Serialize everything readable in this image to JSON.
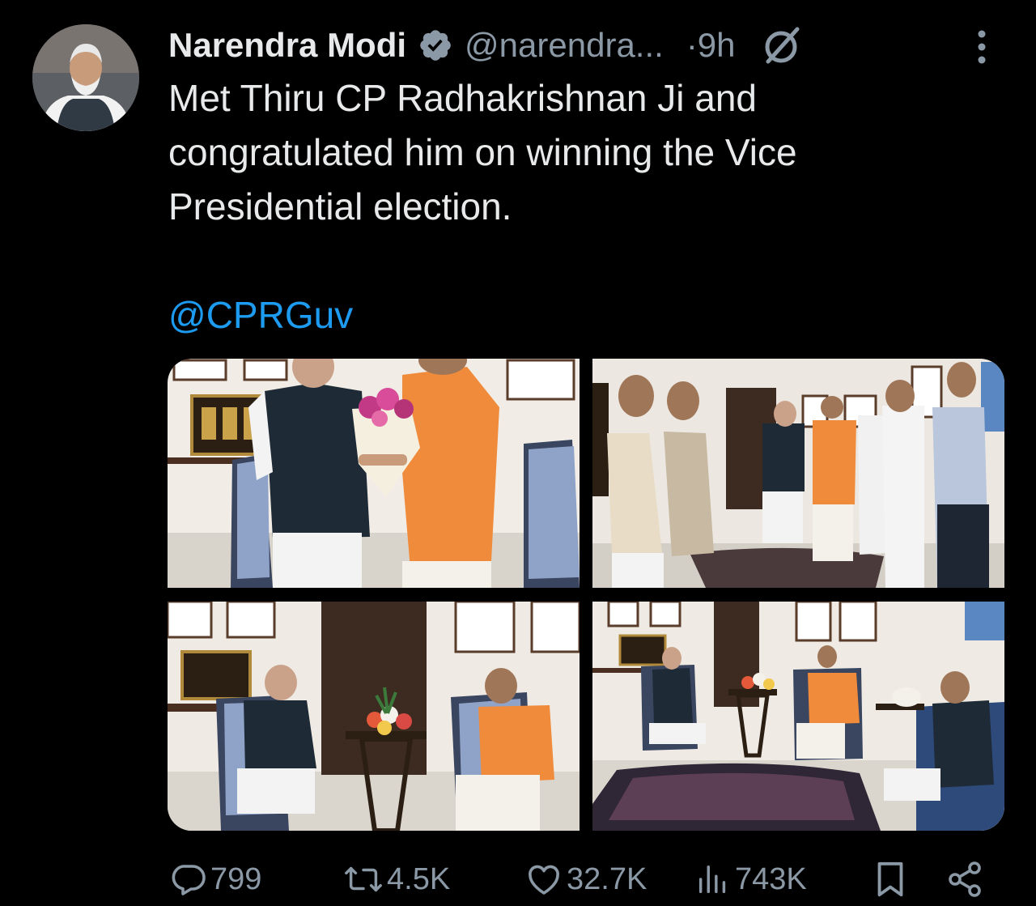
{
  "tweet": {
    "author": {
      "name": "Narendra Modi",
      "handle": "@narendra...",
      "avatar_icon": "avatar-photo"
    },
    "time": "·9h",
    "text": "Met Thiru CP Radhakrishnan Ji and congratulated him on winning the Vice Presidential election.",
    "mention": "@CPRGuv",
    "photos": [
      {
        "name": "photo-handshake-bouquet"
      },
      {
        "name": "photo-group-greeting"
      },
      {
        "name": "photo-seated-pair"
      },
      {
        "name": "photo-seated-wide"
      }
    ]
  },
  "actions": {
    "replies": "799",
    "reposts": "4.5K",
    "likes": "32.7K",
    "views": "743K"
  },
  "colors": {
    "background": "#000000",
    "text": "#e7e9ea",
    "secondary": "#8b98a5",
    "link": "#1d9bf0",
    "verified": "#8b98a5"
  },
  "icons": [
    "verified-icon",
    "grok-icon",
    "more-icon",
    "reply-icon",
    "repost-icon",
    "like-icon",
    "views-icon",
    "bookmark-icon",
    "share-icon"
  ]
}
